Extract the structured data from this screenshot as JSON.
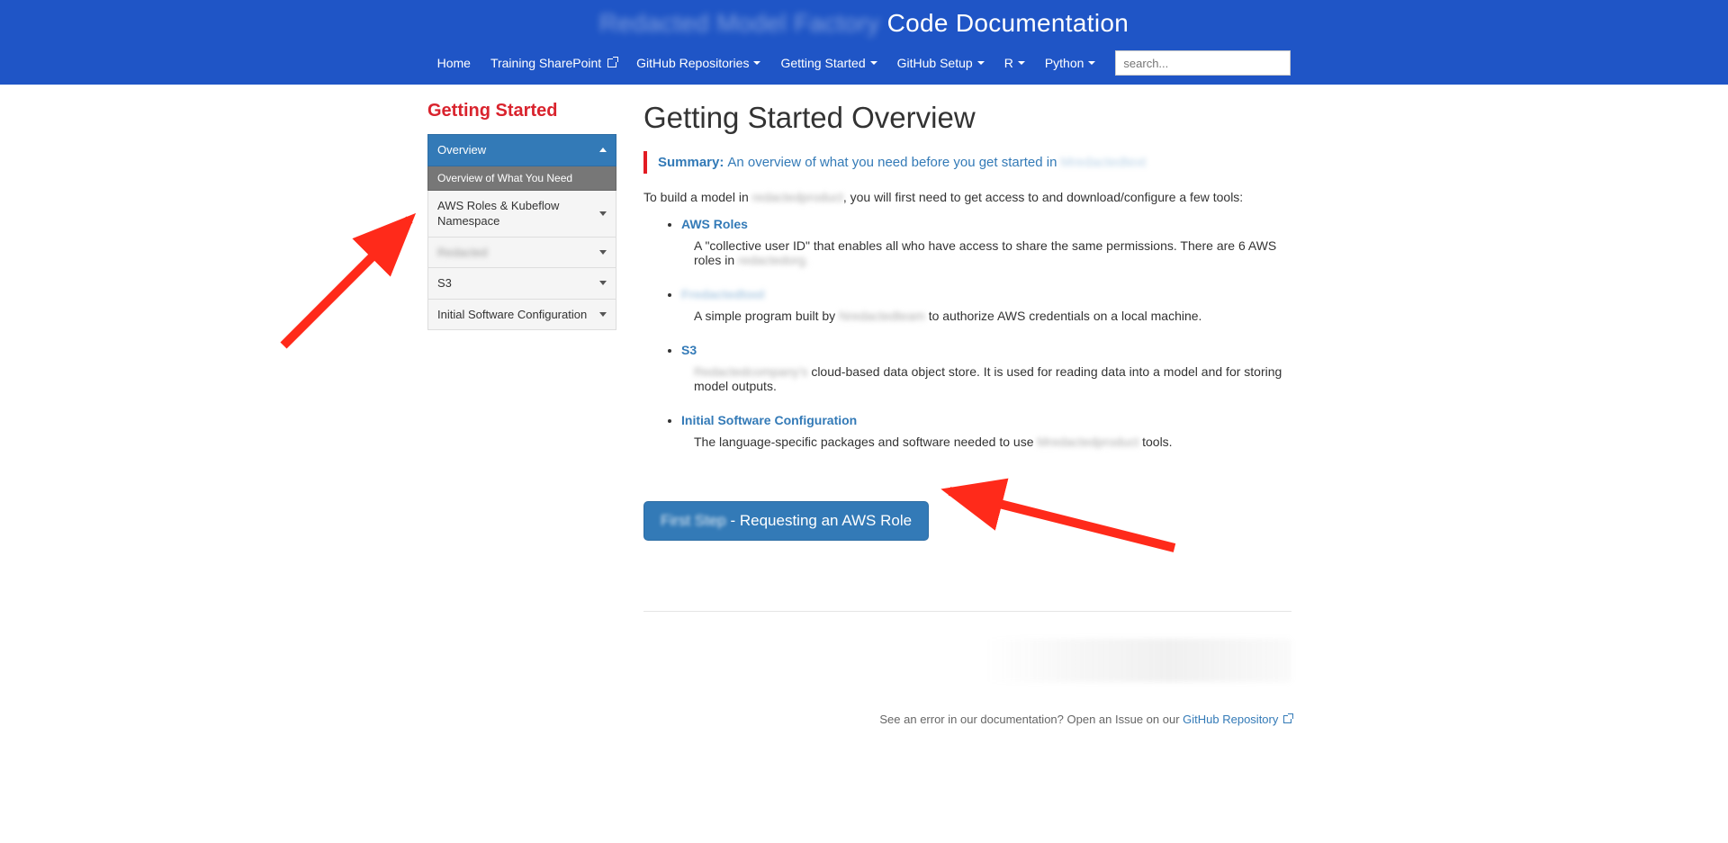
{
  "header": {
    "title_redacted": "Redacted Model Factory",
    "title_suffix": "Code Documentation"
  },
  "nav": {
    "home": "Home",
    "training": "Training SharePoint",
    "repos": "GitHub Repositories",
    "getting_started": "Getting Started",
    "github_setup": "GitHub Setup",
    "r": "R",
    "python": "Python",
    "search_placeholder": "search..."
  },
  "sidebar": {
    "heading": "Getting Started",
    "items": {
      "overview": "Overview",
      "overview_sub": "Overview of What You Need",
      "aws_roles": "AWS Roles & Kubeflow Namespace",
      "item3": "Redacted",
      "s3": "S3",
      "initial_sw": "Initial Software Configuration"
    }
  },
  "main": {
    "title": "Getting Started Overview",
    "summary_label": "Summary:",
    "summary_text": "An overview of what you need before you get started in",
    "summary_redacted": "Mredactedtext",
    "intro_a": "To build a model in",
    "intro_redacted": "redactedproduct",
    "intro_b": ", you will first need to get access to and download/configure a few tools:",
    "topics": {
      "aws_roles": {
        "label": "AWS Roles",
        "desc_a": "A \"collective user ID\" that enables all who have access to share the same permissions. There are 6 AWS roles in",
        "desc_redacted": "redactedorg."
      },
      "second": {
        "label": "Fredactedtool",
        "desc_a": "A simple program built by",
        "desc_redacted": "Nredactedteam",
        "desc_b": "to authorize AWS credentials on a local machine."
      },
      "s3": {
        "label": "S3",
        "desc_redacted": "Redactedcompany's",
        "desc_b": "cloud-based data object store. It is used for reading data into a model and for storing model outputs."
      },
      "sw": {
        "label": "Initial Software Configuration",
        "desc_a": "The language-specific packages and software needed to use",
        "desc_redacted": "Mredactedproduct",
        "desc_b": "tools."
      }
    },
    "cta_prefix": "First Step",
    "cta_suffix": " - Requesting an AWS Role",
    "footnote_a": "See an error in our documentation? Open an Issue on our ",
    "footnote_link": "GitHub Repository"
  }
}
